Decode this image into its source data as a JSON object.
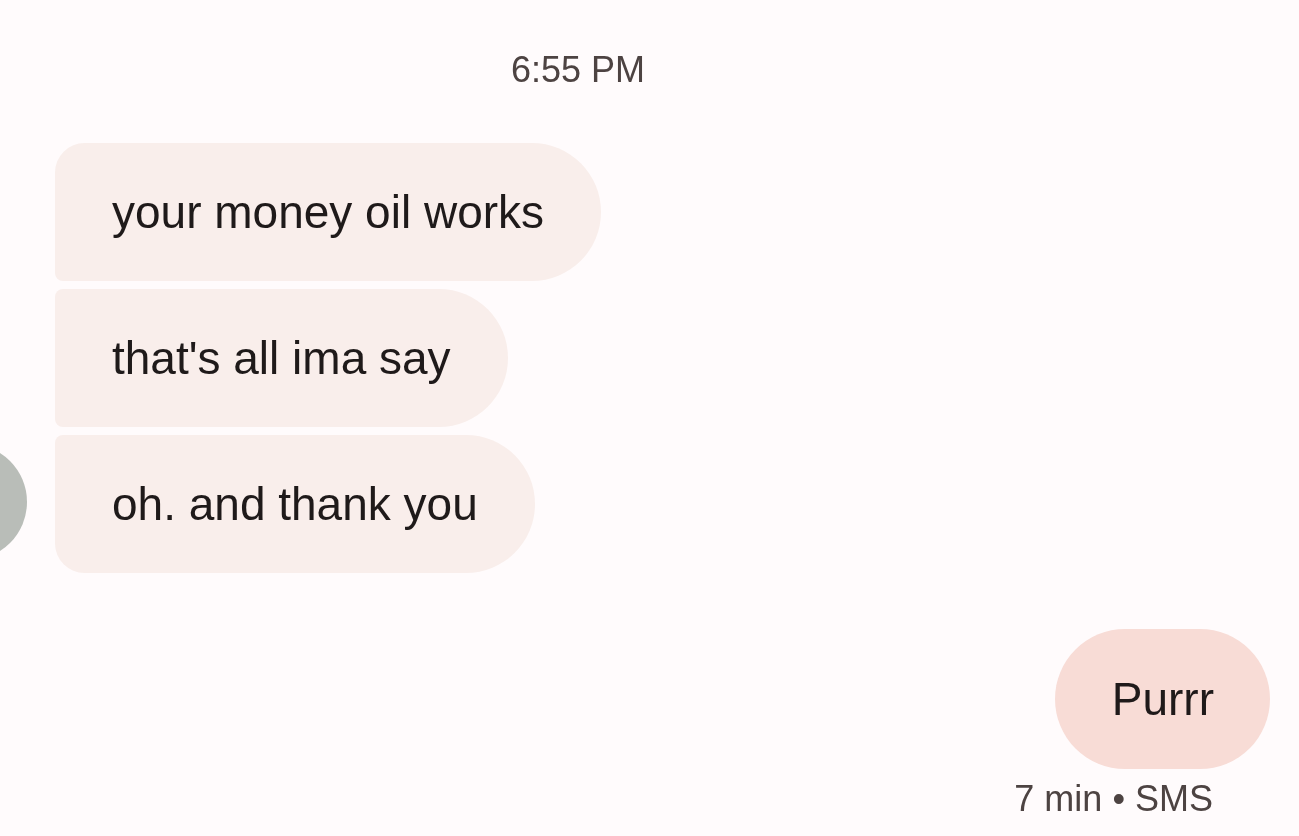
{
  "timestamp": "6:55 PM",
  "received": [
    {
      "text": "your money oil works"
    },
    {
      "text": "that's all ima say"
    },
    {
      "text": "oh. and thank you"
    }
  ],
  "sent": [
    {
      "text": "Purrr"
    }
  ],
  "sent_status": "7 min • SMS"
}
